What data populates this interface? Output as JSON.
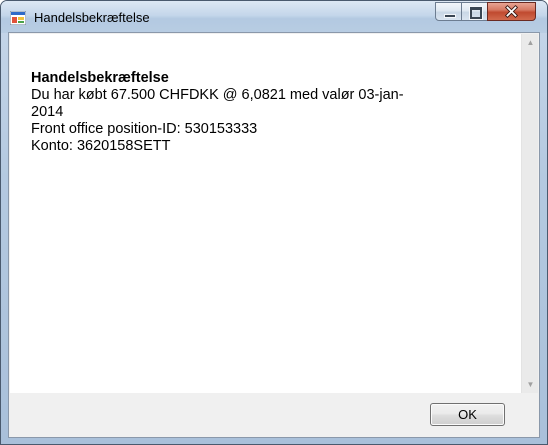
{
  "window": {
    "title": "Handelsbekræftelse"
  },
  "icons": {
    "app": "window-app-icon",
    "minimize": "minimize-icon",
    "maximize": "maximize-icon",
    "close": "close-icon",
    "scroll_up": "scroll-up-arrow-icon",
    "scroll_down": "scroll-down-arrow-icon"
  },
  "message": {
    "heading": "Handelsbekræftelse",
    "lines": [
      "Du har købt 67.500 CHFDKK @ 6,0821 med valør 03-jan-\n2014",
      "Front office position-ID: 530153333",
      "Konto: 3620158SETT"
    ]
  },
  "buttons": {
    "ok_label": "OK"
  },
  "colors": {
    "close_button": "#c04a30",
    "titlebar": "#c4d6ea"
  }
}
